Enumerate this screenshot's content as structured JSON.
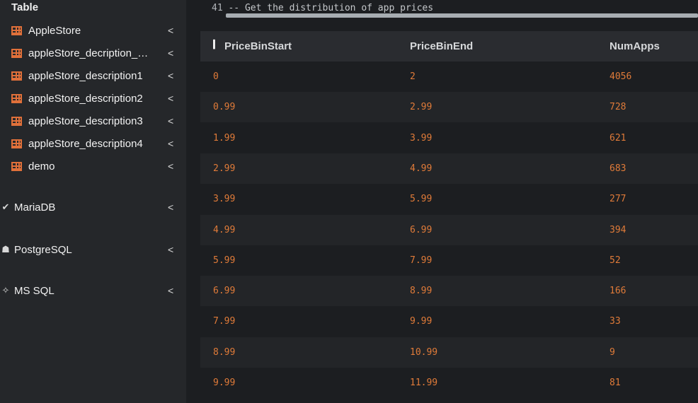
{
  "sidebar": {
    "heading": "Table",
    "tables": [
      {
        "label": "AppleStore"
      },
      {
        "label": "appleStore_decription_…"
      },
      {
        "label": "appleStore_description1"
      },
      {
        "label": "appleStore_description2"
      },
      {
        "label": "appleStore_description3"
      },
      {
        "label": "appleStore_description4"
      },
      {
        "label": "demo"
      }
    ],
    "databases": [
      {
        "label": "MariaDB",
        "icon": "mariadb-icon"
      },
      {
        "label": "PostgreSQL",
        "icon": "postgresql-icon"
      },
      {
        "label": "MS SQL",
        "icon": "mssql-icon"
      }
    ],
    "chevron": "<"
  },
  "query": {
    "line_number": "41",
    "comment": "-- Get the distribution of app prices"
  },
  "results": {
    "columns": [
      "PriceBinStart",
      "PriceBinEnd",
      "NumApps"
    ],
    "rows": [
      [
        "0",
        "2",
        "4056"
      ],
      [
        "0.99",
        "2.99",
        "728"
      ],
      [
        "1.99",
        "3.99",
        "621"
      ],
      [
        "2.99",
        "4.99",
        "683"
      ],
      [
        "3.99",
        "5.99",
        "277"
      ],
      [
        "4.99",
        "6.99",
        "394"
      ],
      [
        "5.99",
        "7.99",
        "52"
      ],
      [
        "6.99",
        "8.99",
        "166"
      ],
      [
        "7.99",
        "9.99",
        "33"
      ],
      [
        "8.99",
        "10.99",
        "9"
      ],
      [
        "9.99",
        "11.99",
        "81"
      ]
    ]
  },
  "colors": {
    "accent": "#e07b39",
    "sidebar_bg": "#25272a",
    "main_bg": "#1c1e21",
    "header_bg": "#2a2c30"
  }
}
